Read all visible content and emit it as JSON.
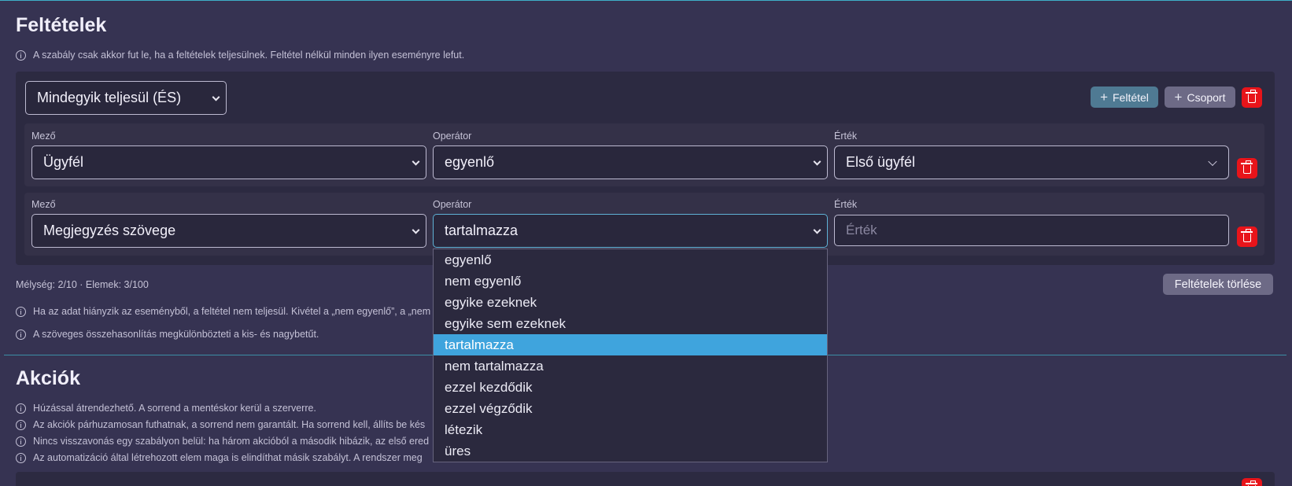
{
  "conditions": {
    "title": "Feltételek",
    "hint": "A szabály csak akkor fut le, ha a feltételek teljesülnek. Feltétel nélkül minden ilyen eseményre lefut.",
    "group_mode": "Mindegyik teljesül (ÉS)",
    "add_condition_label": "Feltétel",
    "add_group_label": "Csoport",
    "rows": [
      {
        "field_label": "Mező",
        "field_value": "Ügyfél",
        "operator_label": "Operátor",
        "operator_value": "egyenlő",
        "value_label": "Érték",
        "value_value": "Első ügyfél"
      },
      {
        "field_label": "Mező",
        "field_value": "Megjegyzés szövege",
        "operator_label": "Operátor",
        "operator_value": "tartalmazza",
        "value_label": "Érték",
        "value_placeholder": "Érték"
      }
    ],
    "stats": "Mélység: 2/10 · Elemek: 3/100",
    "clear_label": "Feltételek törlése",
    "footnotes": [
      "Ha az adat hiányzik az eseményből, a feltétel nem teljesül. Kivétel a „nem egyenlő”, a „nem",
      "A szöveges összehasonlítás megkülönbözteti a kis- és nagybetűt."
    ]
  },
  "operator_dropdown": {
    "options": [
      "egyenlő",
      "nem egyenlő",
      "egyike ezeknek",
      "egyike sem ezeknek",
      "tartalmazza",
      "nem tartalmazza",
      "ezzel kezdődik",
      "ezzel végződik",
      "létezik",
      "üres"
    ],
    "selected_index": 4
  },
  "actions": {
    "title": "Akciók",
    "hints": [
      "Húzással átrendezhető. A sorrend a mentéskor kerül a szerverre.",
      "Az akciók párhuzamosan futhatnak, a sorrend nem garantált. Ha sorrend kell, állíts be kés",
      "Nincs visszavonás egy szabályon belül: ha három akcióból a második hibázik, az első ered",
      "Az automatizáció által létrehozott elem maga is elindíthat másik szabályt. A rendszer meg"
    ]
  },
  "colors": {
    "background": "#363352",
    "panel": "#2c2a41",
    "accent_blue": "#4f7a93",
    "selected_option": "#3fa4dd",
    "danger": "#e8141a"
  }
}
